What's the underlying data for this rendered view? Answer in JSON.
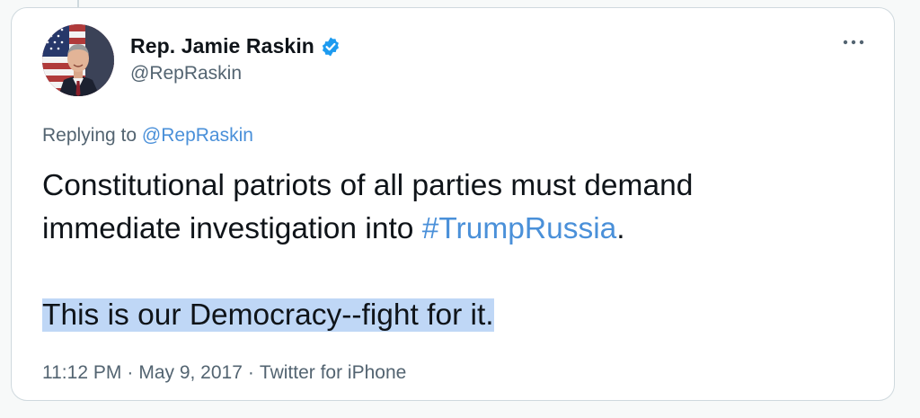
{
  "tweet": {
    "author": {
      "display_name": "Rep. Jamie Raskin",
      "handle": "@RepRaskin",
      "verified": true,
      "avatar": "portrait-with-flag"
    },
    "reply_context": {
      "prefix": "Replying to",
      "mention": "@RepRaskin"
    },
    "text": {
      "line1": "Constitutional patriots of all parties must demand",
      "line2_prefix": "immediate investigation into",
      "hashtag": "#TrumpRussia",
      "line2_suffix": ".",
      "paragraph2": "This is our Democracy--fight for it."
    },
    "meta": {
      "time": "11:12 PM",
      "date": "May 9, 2017",
      "source": "Twitter for iPhone",
      "separator": "·"
    },
    "more_icon": "more-horizontal-icon"
  },
  "colors": {
    "link": "#4a90d9",
    "text": "#0f1419",
    "secondary": "#536471",
    "verified": "#1d9bf0",
    "highlight": "#bfd7f6"
  }
}
